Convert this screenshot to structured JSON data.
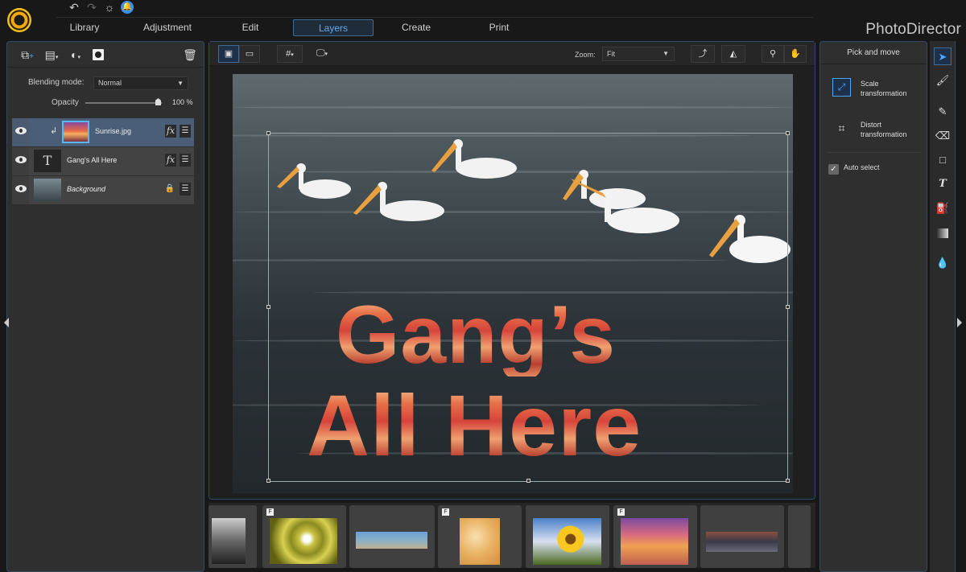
{
  "app": {
    "brand": "PhotoDirector"
  },
  "quick_icons": [
    "undo-icon",
    "redo-icon",
    "settings-icon",
    "notification-icon"
  ],
  "tabs": [
    {
      "label": "Library",
      "active": false
    },
    {
      "label": "Adjustment",
      "active": false
    },
    {
      "label": "Edit",
      "active": false
    },
    {
      "label": "Layers",
      "active": true
    },
    {
      "label": "Create",
      "active": false
    },
    {
      "label": "Print",
      "active": false
    }
  ],
  "left_panel": {
    "tools": [
      "add-layer-icon",
      "layer-menu-icon",
      "adjustment-icon",
      "mask-icon",
      "trash-icon"
    ],
    "blending_label": "Blending mode:",
    "blending_value": "Normal",
    "opacity_label": "Opacity",
    "opacity_value": "100",
    "opacity_unit": "%",
    "opacity_fraction": 1.0,
    "layers": [
      {
        "name": "Sunrise.jpg",
        "selected": true,
        "clipped": true,
        "fx": true,
        "locked": false,
        "italic": false
      },
      {
        "name": "Gang's All Here",
        "selected": false,
        "clipped": false,
        "fx": true,
        "locked": false,
        "italic": false
      },
      {
        "name": "Background",
        "selected": false,
        "clipped": false,
        "fx": false,
        "locked": true,
        "italic": true
      }
    ]
  },
  "canvas_toolbar": {
    "zoom_label": "Zoom:",
    "zoom_value": "Fit"
  },
  "canvas": {
    "text_line1": "Gang’s",
    "text_line2": "All Here"
  },
  "right_panel": {
    "title": "Pick and move",
    "scale_label_1": "Scale",
    "scale_label_2": "transformation",
    "distort_label_1": "Distort",
    "distort_label_2": "transformation",
    "auto_select_label": "Auto select",
    "auto_select_checked": true
  },
  "toolstrip": [
    "pick-move-icon",
    "brush-select-icon",
    "pencil-icon",
    "eraser-icon",
    "rectangle-icon",
    "text-icon",
    "fill-bucket-icon",
    "gradient-icon",
    "drop-icon"
  ],
  "filmstrip": [
    {
      "desc": "bw-landscape",
      "badge": false
    },
    {
      "desc": "spiral-staircase",
      "badge": true
    },
    {
      "desc": "beach-panorama",
      "badge": false
    },
    {
      "desc": "smiling-woman",
      "badge": true
    },
    {
      "desc": "sunflower",
      "badge": false
    },
    {
      "desc": "sunset",
      "badge": true
    },
    {
      "desc": "crowd-panorama",
      "badge": false
    }
  ]
}
